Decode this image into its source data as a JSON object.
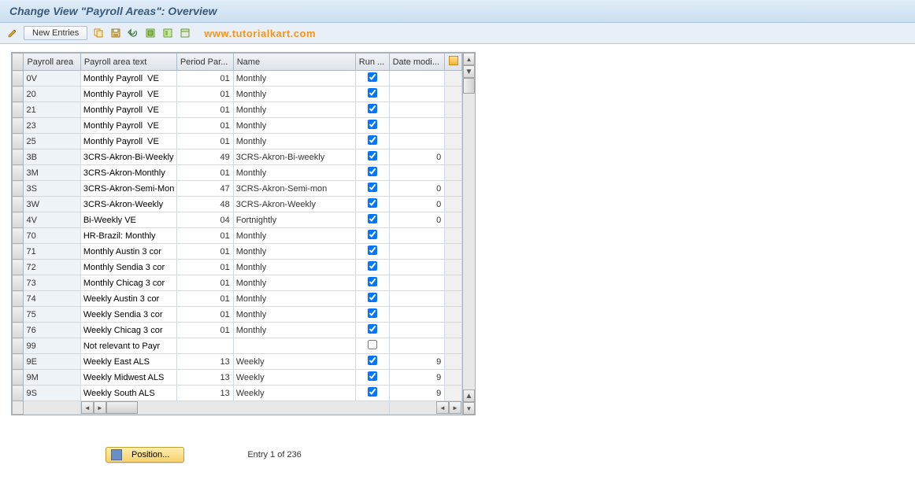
{
  "title": "Change View \"Payroll Areas\": Overview",
  "watermark": "www.tutorialkart.com",
  "toolbar": {
    "new_entries_label": "New Entries"
  },
  "columns": {
    "area": "Payroll area",
    "text": "Payroll area text",
    "period": "Period Par...",
    "name": "Name",
    "run": "Run ...",
    "date": "Date modi..."
  },
  "rows": [
    {
      "area": "0V",
      "text": "Monthly Payroll  VE",
      "period": "01",
      "name": "Monthly",
      "run": true,
      "date": ""
    },
    {
      "area": "20",
      "text": "Monthly Payroll  VE",
      "period": "01",
      "name": "Monthly",
      "run": true,
      "date": ""
    },
    {
      "area": "21",
      "text": "Monthly Payroll  VE",
      "period": "01",
      "name": "Monthly",
      "run": true,
      "date": ""
    },
    {
      "area": "23",
      "text": "Monthly Payroll  VE",
      "period": "01",
      "name": "Monthly",
      "run": true,
      "date": ""
    },
    {
      "area": "25",
      "text": "Monthly Payroll  VE",
      "period": "01",
      "name": "Monthly",
      "run": true,
      "date": ""
    },
    {
      "area": "3B",
      "text": "3CRS-Akron-Bi-Weekly",
      "period": "49",
      "name": "3CRS-Akron-Bi-weekly",
      "run": true,
      "date": "0"
    },
    {
      "area": "3M",
      "text": "3CRS-Akron-Monthly",
      "period": "01",
      "name": "Monthly",
      "run": true,
      "date": ""
    },
    {
      "area": "3S",
      "text": "3CRS-Akron-Semi-Mon",
      "period": "47",
      "name": "3CRS-Akron-Semi-mon",
      "run": true,
      "date": "0"
    },
    {
      "area": "3W",
      "text": "3CRS-Akron-Weekly",
      "period": "48",
      "name": "3CRS-Akron-Weekly",
      "run": true,
      "date": "0"
    },
    {
      "area": "4V",
      "text": "Bi-Weekly VE",
      "period": "04",
      "name": "Fortnightly",
      "run": true,
      "date": "0"
    },
    {
      "area": "70",
      "text": "HR-Brazil: Monthly",
      "period": "01",
      "name": "Monthly",
      "run": true,
      "date": ""
    },
    {
      "area": "71",
      "text": "Monthly Austin 3 cor",
      "period": "01",
      "name": "Monthly",
      "run": true,
      "date": ""
    },
    {
      "area": "72",
      "text": "Monthly Sendia 3 cor",
      "period": "01",
      "name": "Monthly",
      "run": true,
      "date": ""
    },
    {
      "area": "73",
      "text": "Monthly Chicag 3 cor",
      "period": "01",
      "name": "Monthly",
      "run": true,
      "date": ""
    },
    {
      "area": "74",
      "text": "Weekly Austin 3 cor",
      "period": "01",
      "name": "Monthly",
      "run": true,
      "date": ""
    },
    {
      "area": "75",
      "text": "Weekly Sendia 3 cor",
      "period": "01",
      "name": "Monthly",
      "run": true,
      "date": ""
    },
    {
      "area": "76",
      "text": "Weekly Chicag 3 cor",
      "period": "01",
      "name": "Monthly",
      "run": true,
      "date": ""
    },
    {
      "area": "99",
      "text": "Not relevant to Payr",
      "period": "",
      "name": "",
      "run": false,
      "date": ""
    },
    {
      "area": "9E",
      "text": "Weekly East ALS",
      "period": "13",
      "name": "Weekly",
      "run": true,
      "date": "9"
    },
    {
      "area": "9M",
      "text": "Weekly Midwest ALS",
      "period": "13",
      "name": "Weekly",
      "run": true,
      "date": "9"
    },
    {
      "area": "9S",
      "text": "Weekly South ALS",
      "period": "13",
      "name": "Weekly",
      "run": true,
      "date": "9"
    }
  ],
  "footer": {
    "position_label": "Position...",
    "entry_text": "Entry 1 of 236"
  }
}
